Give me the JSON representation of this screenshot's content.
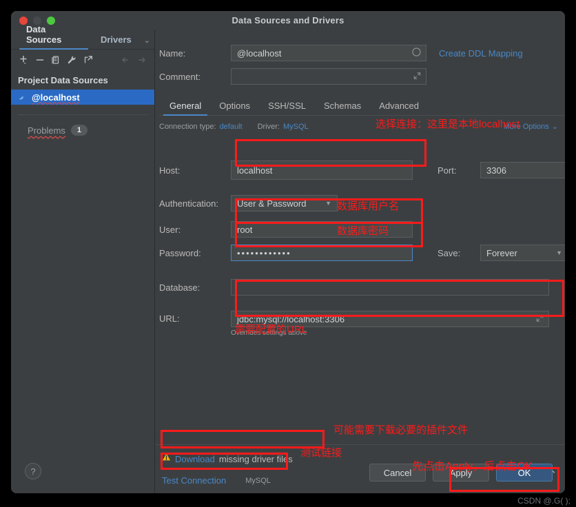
{
  "window": {
    "title": "Data Sources and Drivers",
    "traffic_lights": [
      "close-red",
      "minimize-gray",
      "maximize-green"
    ]
  },
  "sidebar": {
    "tabs": [
      {
        "label": "Data Sources",
        "selected": true
      },
      {
        "label": "Drivers",
        "selected": false
      }
    ],
    "tabs_chevron": "⌄",
    "toolbar_icons": [
      "add-icon",
      "remove-icon",
      "copy-icon",
      "wrench-icon",
      "external-link-icon",
      "back-arrow-icon",
      "forward-arrow-icon"
    ],
    "section_title": "Project Data Sources",
    "data_source": {
      "name": "@localhost",
      "icon": "mysql-dolphin-icon"
    },
    "problems": {
      "label": "Problems",
      "count": "1"
    }
  },
  "form": {
    "name_label": "Name:",
    "name_value": "@localhost",
    "name_icon": "circle-icon",
    "create_ddl_link": "Create DDL Mapping",
    "comment_label": "Comment:",
    "comment_value": "",
    "comment_icon": "expand-icon",
    "tabs": [
      {
        "label": "General",
        "selected": true
      },
      {
        "label": "Options",
        "selected": false
      },
      {
        "label": "SSH/SSL",
        "selected": false
      },
      {
        "label": "Schemas",
        "selected": false
      },
      {
        "label": "Advanced",
        "selected": false
      }
    ],
    "connection_type_label": "Connection type:",
    "connection_type_value": "default",
    "driver_label": "Driver:",
    "driver_value": "MySQL",
    "more_options": "More Options",
    "more_options_chevron": "⌄",
    "host_label": "Host:",
    "host_value": "localhost",
    "port_label": "Port:",
    "port_value": "3306",
    "auth_label": "Authentication:",
    "auth_value": "User & Password",
    "user_label": "User:",
    "user_value": "root",
    "password_label": "Password:",
    "password_value": "••••••••••••",
    "save_label": "Save:",
    "save_value": "Forever",
    "database_label": "Database:",
    "database_value": "",
    "url_label": "URL:",
    "url_value": "jdbc:mysql://localhost:3306",
    "url_icon": "expand-icon",
    "url_hint": "Overrides settings above",
    "download_warning_icon": "warning-triangle-icon",
    "download_link": "Download",
    "download_rest": "missing driver files",
    "test_connection": "Test Connection",
    "test_connection_driver": "MySQL",
    "revert_icon": "revert-arrow-icon"
  },
  "buttons": {
    "help": "?",
    "cancel": "Cancel",
    "apply": "Apply",
    "ok": "OK"
  },
  "annotations": [
    {
      "id": "connection",
      "text": "选择连接：这里是本地localhost"
    },
    {
      "id": "username",
      "text": "数据库用户名"
    },
    {
      "id": "password",
      "text": "数据库密码"
    },
    {
      "id": "url",
      "text": "需要配置的URL"
    },
    {
      "id": "driver",
      "text": "可能需要下载必要的插件文件"
    },
    {
      "id": "test",
      "text": "测试链接"
    },
    {
      "id": "buttons",
      "text": "先点击Apply，后点击OK"
    }
  ],
  "watermark": "CSDN @.G( );",
  "colors": {
    "accent_blue": "#4a88c7",
    "selection_blue": "#2a6ac4",
    "annotation_red": "#fc1b1b",
    "primary_button": "#365880",
    "window_bg": "#3c3f41",
    "warning_yellow": "#f0b400"
  }
}
